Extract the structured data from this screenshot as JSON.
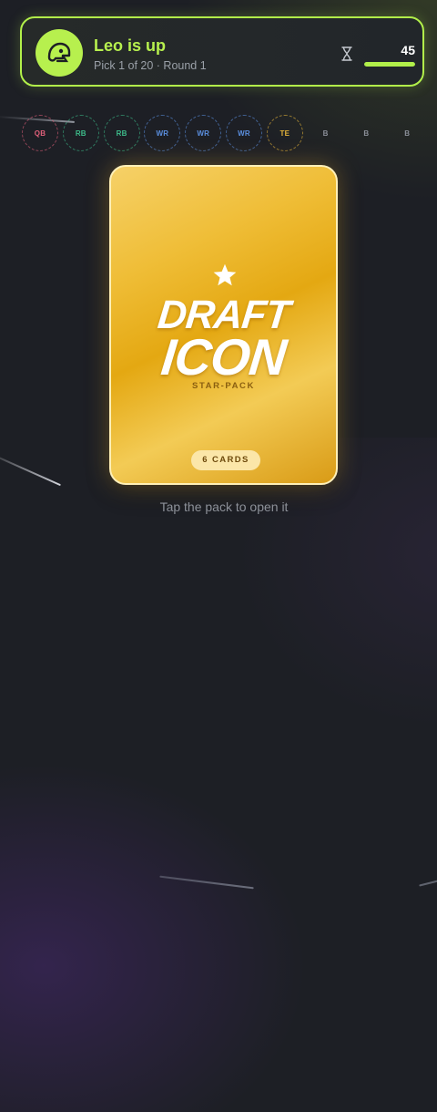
{
  "header": {
    "title": "Leo is up",
    "subtitle": "Pick 1 of 20 · Round 1",
    "timer": "45",
    "timer_progress": 1.0,
    "accent_color": "#b2f04a",
    "avatar_icon": "helmet-icon",
    "timer_icon": "hourglass-icon"
  },
  "roster": {
    "slots": [
      {
        "label": "QB",
        "color": "#e0607a"
      },
      {
        "label": "RB",
        "color": "#3dbb8a"
      },
      {
        "label": "RB",
        "color": "#3dbb8a"
      },
      {
        "label": "WR",
        "color": "#5b8fe0"
      },
      {
        "label": "WR",
        "color": "#5b8fe0"
      },
      {
        "label": "WR",
        "color": "#5b8fe0"
      },
      {
        "label": "TE",
        "color": "#e5b43a"
      },
      {
        "label": "B",
        "color": "#8a8f98"
      },
      {
        "label": "B",
        "color": "#8a8f98"
      },
      {
        "label": "B",
        "color": "#8a8f98"
      }
    ]
  },
  "pack": {
    "line1": "DRAFT",
    "line2": "ICON",
    "subtitle": "STAR-PACK",
    "badge": "6 CARDS",
    "icon": "star-icon"
  },
  "hint": "Tap the pack to open it"
}
